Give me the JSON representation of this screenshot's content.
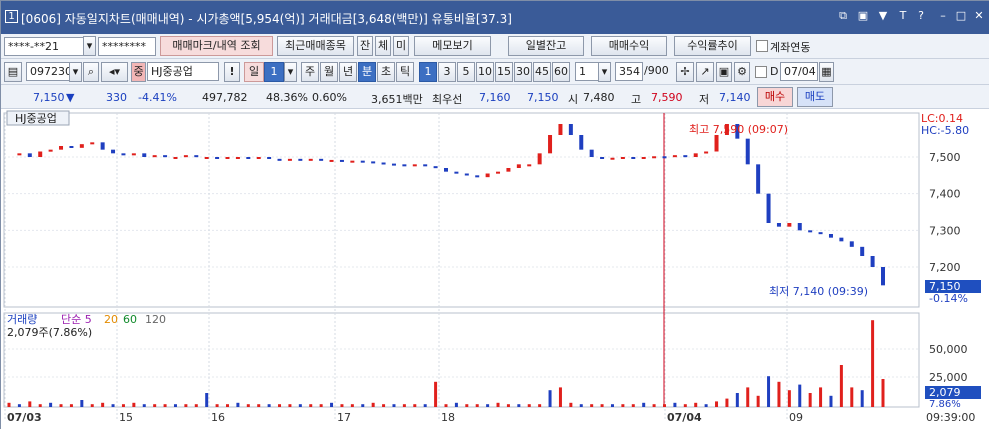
{
  "window": {
    "number": "1",
    "title": "[0606] 자동일지차트(매매내역) - 시가총액[5,954(억)] 거래대금[3,648(백만)] 유통비율[37.3]",
    "buttons": [
      "⧉",
      "▣",
      "▼",
      "T",
      "?",
      "–",
      "□",
      "✕"
    ]
  },
  "toolbar1": {
    "account": "****-**21",
    "password": "********",
    "trade_mark_btn": "매매마크/내역 조회",
    "recent_btn": "최근매매종목",
    "jan": "잔",
    "che": "체",
    "mi": "미",
    "memo_btn": "메모보기",
    "daily_btn": "일별잔고",
    "profit_btn": "매매수익",
    "rate_btn": "수익률추이",
    "link_label": "계좌연동"
  },
  "toolbar2": {
    "code": "097230",
    "name": "HJ중공업",
    "mark": "!",
    "period_sel": "일",
    "period_num": "1",
    "periods": [
      "주",
      "월",
      "년",
      "분",
      "초",
      "틱"
    ],
    "intervals": [
      "1",
      "3",
      "5",
      "10",
      "15",
      "30",
      "45",
      "60"
    ],
    "custom": "1",
    "count": "354",
    "total": "/900",
    "d_label": "D",
    "date": "07/04"
  },
  "info": {
    "price": "7,150",
    "arrow": "▼",
    "change": "330",
    "change_pct": "-4.41%",
    "volume": "497,782",
    "vol_ratio": "48.36%",
    "turnover": "0.60%",
    "amount": "3,651백만",
    "best_label": "최우선",
    "ask": "7,160",
    "bid": "7,150",
    "open_label": "시",
    "open": "7,480",
    "high_label": "고",
    "high": "7,590",
    "low_label": "저",
    "low": "7,140",
    "buy": "매수",
    "sell": "매도"
  },
  "chart": {
    "stock_name": "HJ중공업",
    "lc": "LC:0.14",
    "hc": "HC:-5.80",
    "high_note": "최고 7,590 (09:07)",
    "low_note": "최저 7,140 (09:39)",
    "price_ticks": [
      "7,500",
      "7,400",
      "7,300",
      "7,200"
    ],
    "cur_price": "7,150",
    "cur_pct": "-0.14%",
    "vol_legend": {
      "name": "거래량",
      "ma": "단순 5",
      "ma20": "20",
      "ma60": "60",
      "ma120": "120"
    },
    "vol_value": "2,079주(7.86%)",
    "vol_ticks": [
      "50,000",
      "25,000"
    ],
    "vol_cur": "2,079",
    "vol_pct": "7.86%",
    "x_labels": [
      "07/03",
      "15",
      "16",
      "17",
      "18",
      "07/04",
      "09"
    ],
    "time_label": "09:39:00"
  },
  "colors": {
    "up": "#e0201c",
    "down": "#1f3fc0",
    "title": "#3a5b98"
  }
}
